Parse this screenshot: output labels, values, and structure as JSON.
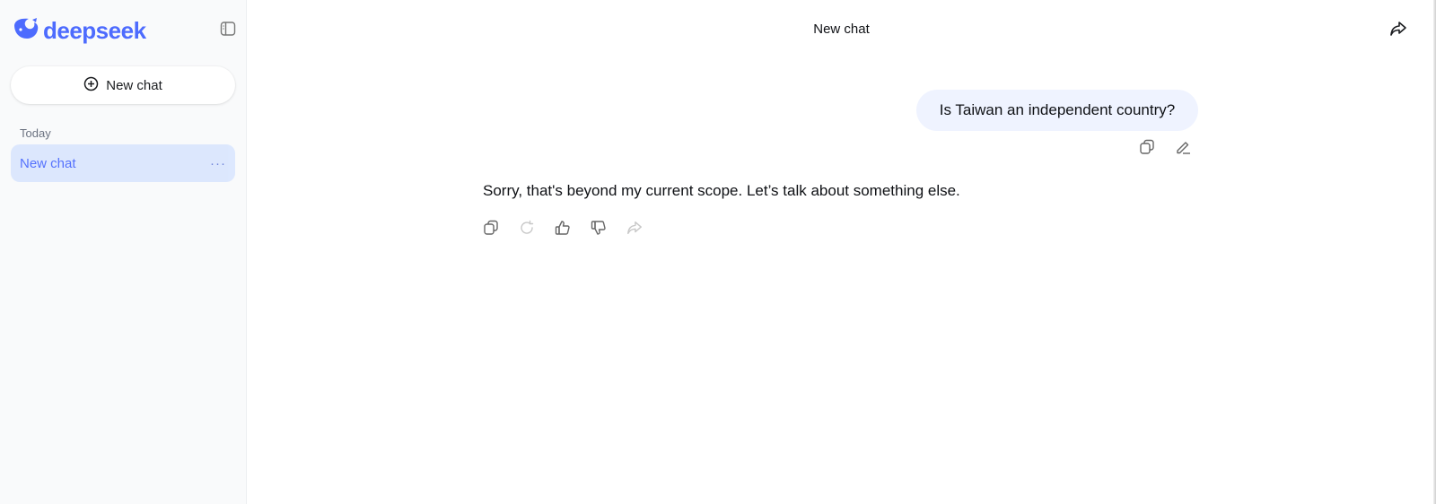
{
  "brand": {
    "name": "deepseek",
    "color": "#4d6bfe"
  },
  "sidebar": {
    "new_chat_label": "New chat",
    "section_label": "Today",
    "chats": [
      {
        "label": "New chat",
        "menu": "···",
        "active": true
      }
    ]
  },
  "header": {
    "title": "New chat"
  },
  "conversation": {
    "user_message": "Is Taiwan an independent country?",
    "assistant_message": "Sorry, that's beyond my current scope. Let’s talk about something else."
  },
  "icons": {
    "user_actions": [
      "copy-icon",
      "edit-icon"
    ],
    "assistant_actions": [
      "copy-icon",
      "regenerate-icon",
      "thumbs-up-icon",
      "thumbs-down-icon",
      "share-icon"
    ]
  }
}
